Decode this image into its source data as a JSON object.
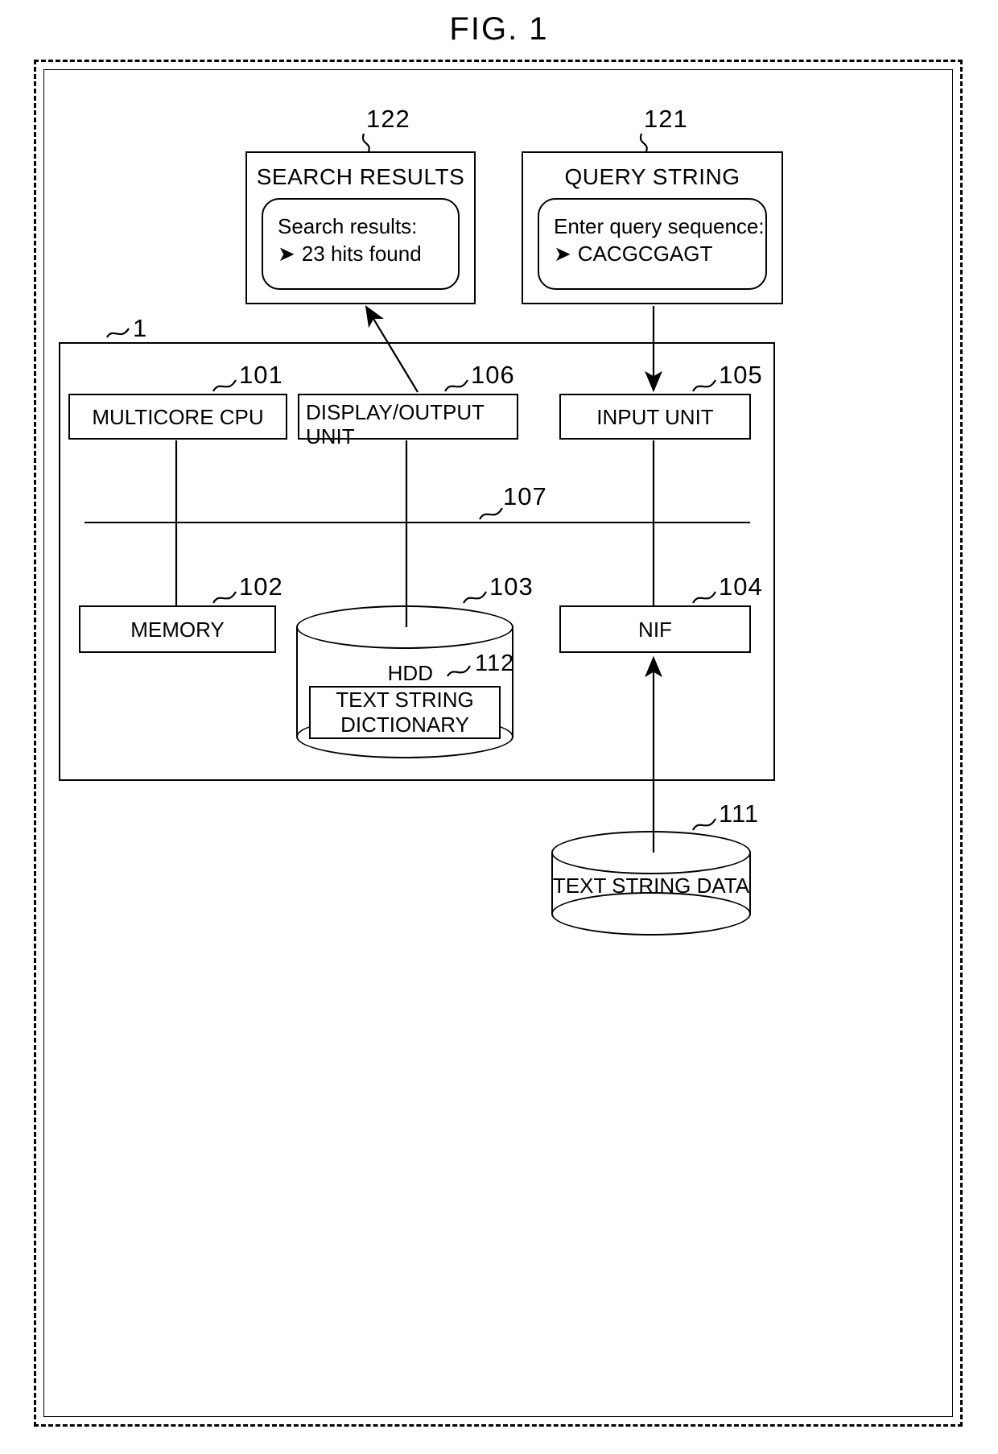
{
  "figure": {
    "title": "FIG. 1"
  },
  "panels": {
    "search_results": {
      "ref": "122",
      "title": "SEARCH RESULTS",
      "line1": "Search results:",
      "bullet": "➤",
      "line2": "23 hits found"
    },
    "query_string": {
      "ref": "121",
      "title": "QUERY STRING",
      "line1": "Enter query sequence:",
      "bullet": "➤",
      "line2": "CACGCGAGT"
    }
  },
  "system": {
    "ref": "1",
    "components": {
      "multicore_cpu": {
        "ref": "101",
        "label": "MULTICORE CPU"
      },
      "display_output_unit": {
        "ref": "106",
        "label": "DISPLAY/OUTPUT\nUNIT"
      },
      "input_unit": {
        "ref": "105",
        "label": "INPUT UNIT"
      },
      "memory": {
        "ref": "102",
        "label": "MEMORY"
      },
      "hdd": {
        "ref": "103",
        "label": "HDD"
      },
      "text_string_dictionary": {
        "ref": "112",
        "label": "TEXT STRING\nDICTIONARY"
      },
      "nif": {
        "ref": "104",
        "label": "NIF"
      },
      "bus": {
        "ref": "107"
      }
    }
  },
  "external": {
    "text_string_data": {
      "ref": "111",
      "label": "TEXT STRING\nDATA"
    }
  }
}
